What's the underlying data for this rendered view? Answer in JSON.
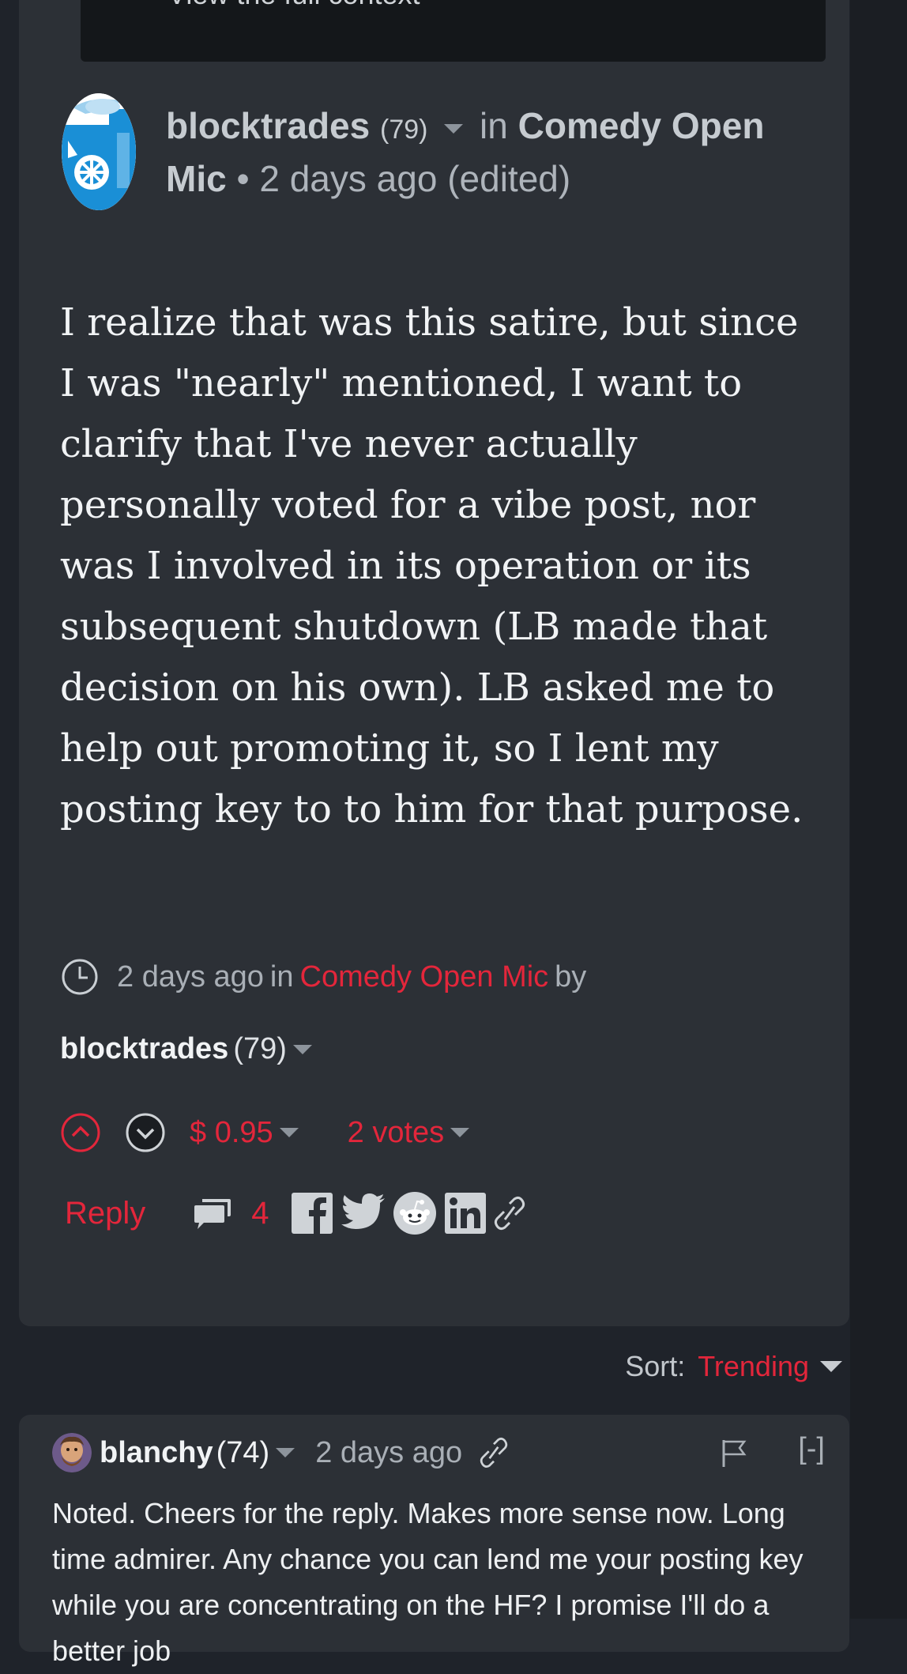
{
  "context": {
    "link_text": "View the full context"
  },
  "post": {
    "author": "blocktrades",
    "reputation": "(79)",
    "in_label": "in",
    "community": "Comedy Open Mic",
    "separator": "•",
    "age": "2 days ago",
    "edited": "(edited)",
    "body": "I realize that was this satire, but since I was \"nearly\" mentioned, I want to clarify that I've never actually personally voted for a vibe post, nor was I involved in its operation or its subsequent shutdown (LB made that decision on his own). LB asked me to help out promoting it, so I lent my posting key to to him for that purpose.",
    "meta": {
      "age": "2 days ago",
      "in_label": "in",
      "community": "Comedy Open Mic",
      "by_label": "by"
    },
    "payout": "$ 0.95",
    "votes": "2 votes",
    "reply_label": "Reply",
    "comment_count": "4"
  },
  "sort": {
    "label": "Sort:",
    "value": "Trending"
  },
  "reply": {
    "author": "blanchy",
    "reputation": "(74)",
    "age": "2 days ago",
    "collapse": "[-]",
    "body": "Noted. Cheers for the reply. Makes more sense now. Long time admirer. Any chance you can lend me your posting key while you are concentrating on the HF? I promise I'll do a better job"
  },
  "colors": {
    "accent": "#e3263b",
    "card": "#2c3036",
    "background": "#1f232a"
  },
  "icons": [
    "clock-icon",
    "upvote-icon",
    "downvote-icon",
    "comment-icon",
    "facebook-icon",
    "twitter-icon",
    "reddit-icon",
    "linkedin-icon",
    "link-icon",
    "flag-icon"
  ]
}
